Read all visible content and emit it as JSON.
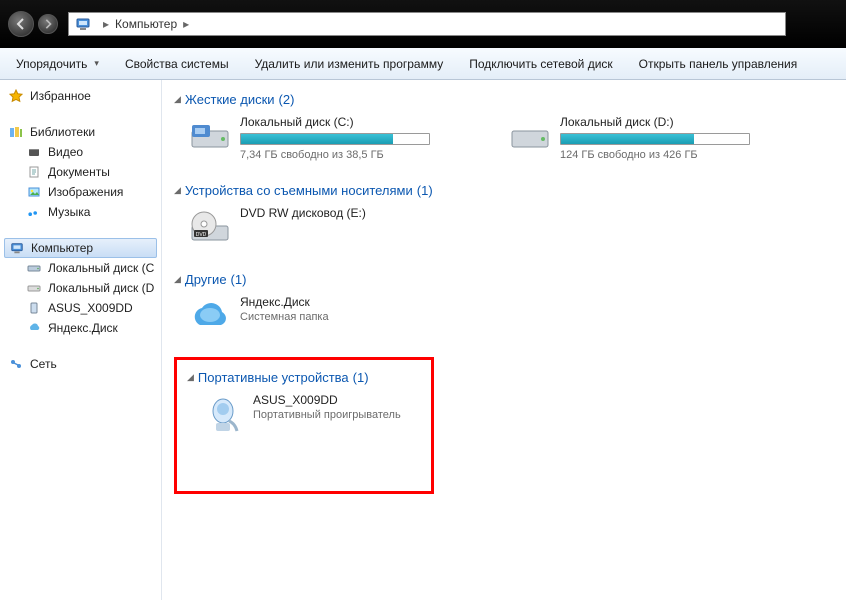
{
  "addressbar": {
    "location": "Компьютер"
  },
  "toolbar": {
    "organize": "Упорядочить",
    "sysprops": "Свойства системы",
    "uninstall": "Удалить или изменить программу",
    "mapdrive": "Подключить сетевой диск",
    "controlpanel": "Открыть панель управления"
  },
  "sidebar": {
    "favorites": "Избранное",
    "libraries": {
      "label": "Библиотеки",
      "video": "Видео",
      "documents": "Документы",
      "pictures": "Изображения",
      "music": "Музыка"
    },
    "computer": {
      "label": "Компьютер",
      "c": "Локальный диск (C",
      "d": "Локальный диск (D",
      "asus": "ASUS_X009DD",
      "yandex": "Яндекс.Диск"
    },
    "network": "Сеть"
  },
  "sections": {
    "hdd": {
      "title": "Жесткие диски",
      "count": "(2)",
      "c": {
        "name": "Локальный диск (C:)",
        "free": "7,34 ГБ свободно из 38,5 ГБ",
        "fill": 81
      },
      "d": {
        "name": "Локальный диск (D:)",
        "free": "124 ГБ свободно из 426 ГБ",
        "fill": 71
      }
    },
    "removable": {
      "title": "Устройства со съемными носителями",
      "count": "(1)",
      "dvd": {
        "name": "DVD RW дисковод (E:)"
      }
    },
    "other": {
      "title": "Другие",
      "count": "(1)",
      "yandex": {
        "name": "Яндекс.Диск",
        "sub": "Системная папка"
      }
    },
    "portable": {
      "title": "Портативные устройства",
      "count": "(1)",
      "asus": {
        "name": "ASUS_X009DD",
        "sub": "Портативный проигрыватель"
      }
    }
  }
}
